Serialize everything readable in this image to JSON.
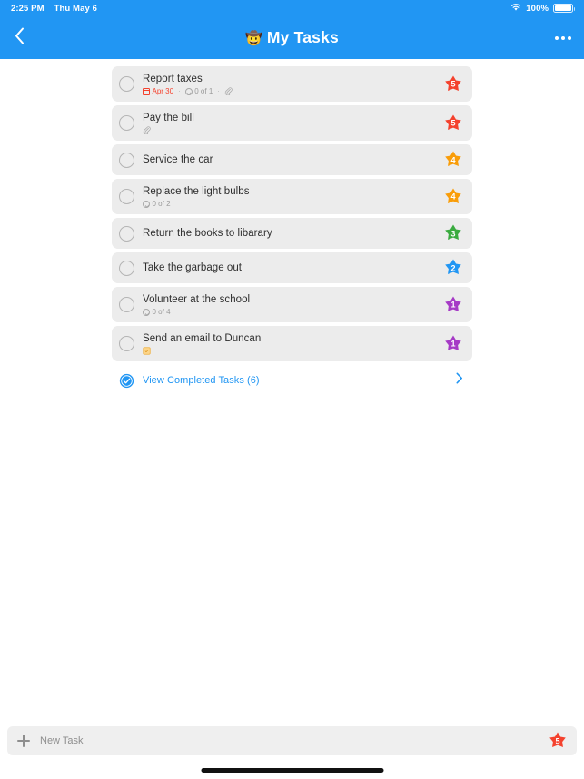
{
  "status_bar": {
    "time": "2:25 PM",
    "date": "Thu May 6",
    "battery_percent": "100%",
    "wifi_icon": "wifi-icon",
    "battery_icon": "battery-full-icon"
  },
  "nav": {
    "back_icon": "chevron-left-icon",
    "title_emoji": "🤠",
    "title": "My Tasks",
    "more_icon": "ellipsis-icon"
  },
  "colors": {
    "accent": "#2196f3",
    "row_bg": "#ececec",
    "priority_5": "#f4422e",
    "priority_4": "#f99d09",
    "priority_3": "#3aab3f",
    "priority_2": "#2196f3",
    "priority_1": "#a63bc6",
    "due_text": "#f4422e",
    "meta_text": "#9a9a9a"
  },
  "tasks": [
    {
      "title": "Report taxes",
      "due": "Apr 30",
      "subtasks": "0 of 1",
      "has_attachment": true,
      "has_note": false,
      "priority": "5",
      "priority_color": "#f4422e"
    },
    {
      "title": "Pay the bill",
      "due": "",
      "subtasks": "",
      "has_attachment": true,
      "has_note": false,
      "priority": "5",
      "priority_color": "#f4422e"
    },
    {
      "title": "Service the car",
      "due": "",
      "subtasks": "",
      "has_attachment": false,
      "has_note": false,
      "priority": "4",
      "priority_color": "#f99d09"
    },
    {
      "title": "Replace the light bulbs",
      "due": "",
      "subtasks": "0 of 2",
      "has_attachment": false,
      "has_note": false,
      "priority": "4",
      "priority_color": "#f99d09"
    },
    {
      "title": "Return the books to libarary",
      "due": "",
      "subtasks": "",
      "has_attachment": false,
      "has_note": false,
      "priority": "3",
      "priority_color": "#3aab3f"
    },
    {
      "title": "Take the garbage out",
      "due": "",
      "subtasks": "",
      "has_attachment": false,
      "has_note": false,
      "priority": "2",
      "priority_color": "#2196f3"
    },
    {
      "title": "Volunteer at the school",
      "due": "",
      "subtasks": "0 of 4",
      "has_attachment": false,
      "has_note": false,
      "priority": "1",
      "priority_color": "#a63bc6"
    },
    {
      "title": "Send an email to Duncan",
      "due": "",
      "subtasks": "",
      "has_attachment": false,
      "has_note": true,
      "priority": "1",
      "priority_color": "#a63bc6"
    }
  ],
  "completed": {
    "label": "View Completed Tasks (6)",
    "icon": "check-circle-icon",
    "chevron_icon": "chevron-right-icon"
  },
  "new_task": {
    "plus_icon": "plus-icon",
    "placeholder": "New Task",
    "value": "",
    "priority": "5",
    "priority_color": "#f4422e"
  }
}
